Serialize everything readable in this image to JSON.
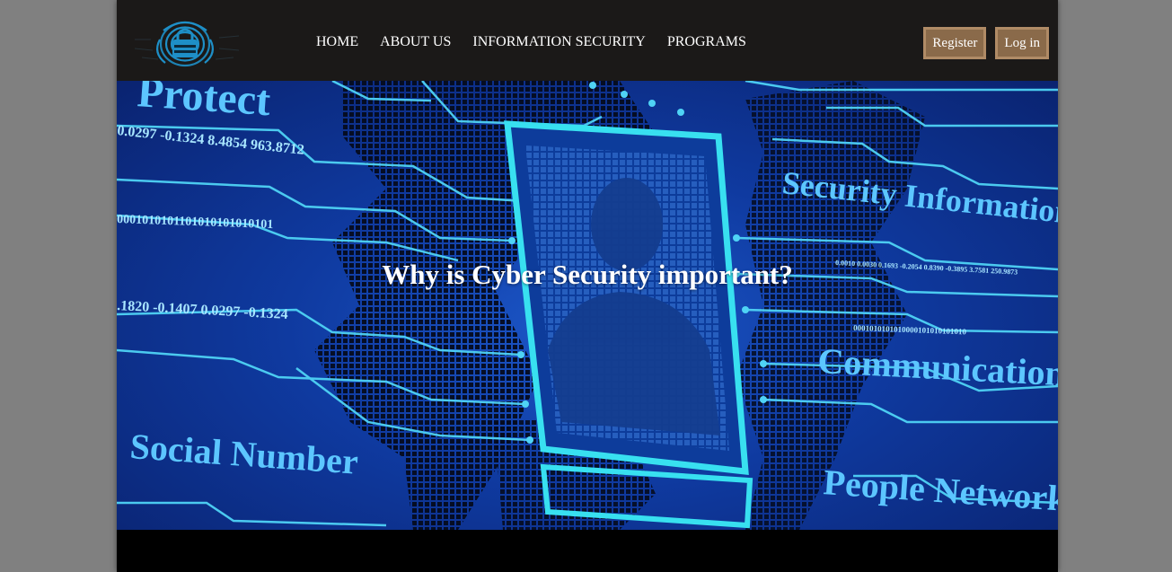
{
  "nav": {
    "links": [
      "HOME",
      "ABOUT US",
      "INFORMATION SECURITY",
      "PROGRAMS"
    ],
    "register_label": "Register",
    "login_label": "Log in"
  },
  "hero": {
    "title": "Why is Cyber Security important?",
    "image_texts": {
      "protect": "Protect",
      "numbers_top": "0.0297 -0.1324 8.4854 963.8712",
      "binary": "0001010101101010101010101",
      "numbers_mid": ".1820 -0.1407 0.0297 -0.1324",
      "social": "Social Number",
      "security": "Security Information",
      "numbers_right": "0.0010 0.0030 0.1693 -0.2054 0.8390 -0.3895 3.7581 250.9873",
      "binary_right": "0001010101010000101010101010",
      "communication": "Communication",
      "people": "People Network"
    }
  },
  "colors": {
    "navbar": "#1b1918",
    "button_bg": "#8a6a4a",
    "button_border": "#b08b66",
    "hero_blue": "#0f3aa0",
    "circuit": "#4fd3f5"
  }
}
